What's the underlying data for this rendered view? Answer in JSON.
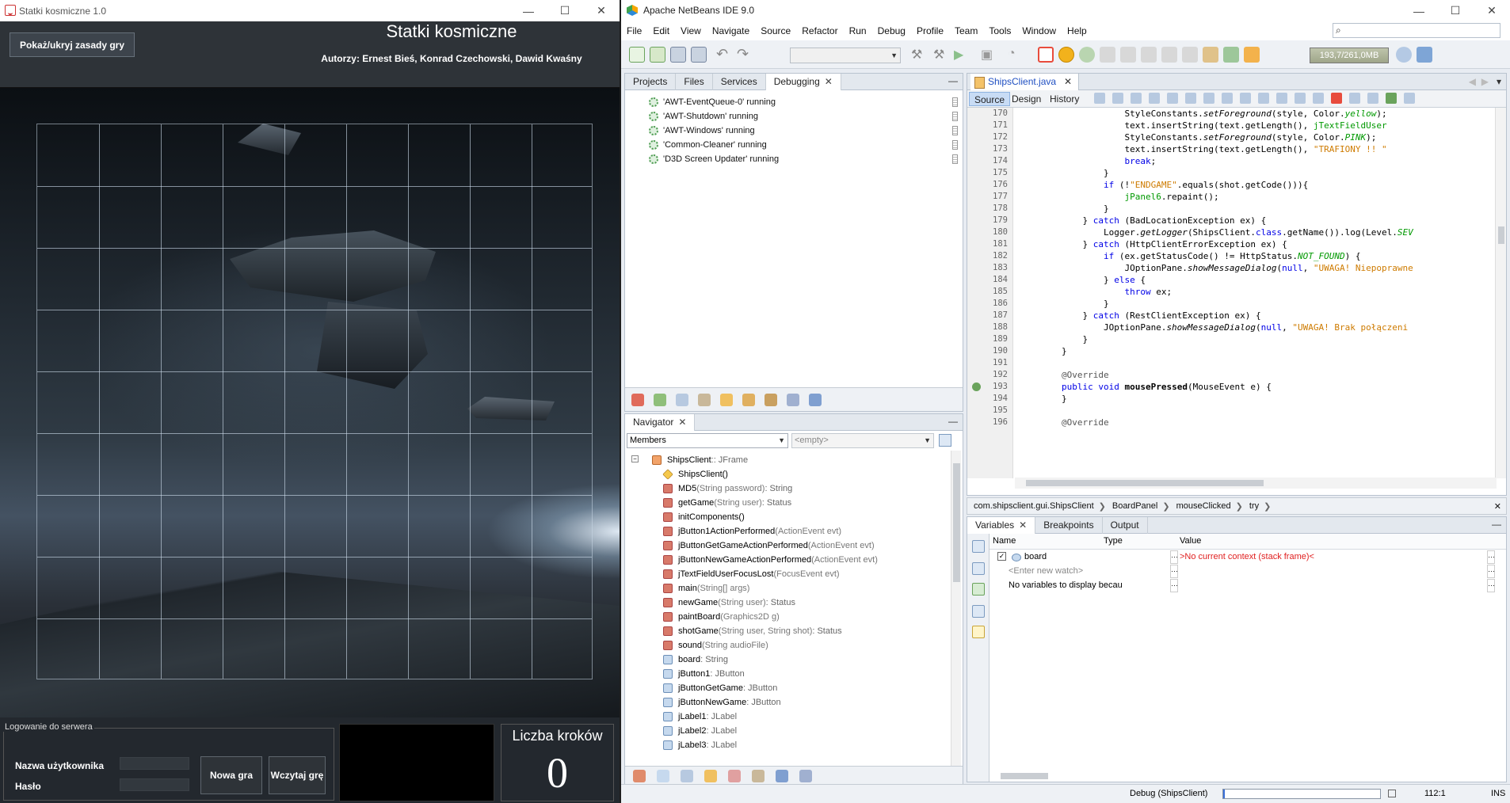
{
  "game_window": {
    "title": "Statki kosmiczne 1.0",
    "rules_button": "Pokaż/ukryj zasady gry",
    "heading": "Statki kosmiczne",
    "authors": "Autorzy: Ernest Bieś, Konrad Czechowski, Dawid Kwaśny",
    "login_legend": "Logowanie do serwera",
    "username_label": "Nazwa użytkownika",
    "password_label": "Hasło",
    "new_game_button": "Nowa gra",
    "load_game_button": "Wczytaj grę",
    "steps_title": "Liczba kroków",
    "steps_value": "0",
    "window_controls": [
      "—",
      "☐",
      "✕"
    ]
  },
  "ide": {
    "title": "Apache NetBeans IDE 9.0",
    "window_controls": [
      "—",
      "☐",
      "✕"
    ],
    "menu": [
      "File",
      "Edit",
      "View",
      "Navigate",
      "Source",
      "Refactor",
      "Run",
      "Debug",
      "Profile",
      "Team",
      "Tools",
      "Window",
      "Help"
    ],
    "memory": "193,7/261,0MB",
    "panes": {
      "top_tabs": [
        "Projects",
        "Files",
        "Services",
        "Debugging"
      ],
      "threads": [
        "'AWT-EventQueue-0' running",
        "'AWT-Shutdown' running",
        "'AWT-Windows' running",
        "'Common-Cleaner' running",
        "'D3D Screen Updater' running"
      ],
      "navigator_tab": "Navigator",
      "navigator_filter": "Members",
      "navigator_filter2": "<empty>",
      "members": [
        {
          "name": "ShipsClient",
          "ret": " :: JFrame",
          "par": ""
        },
        {
          "name": "ShipsClient()",
          "ret": "",
          "par": ""
        },
        {
          "name": "MD5",
          "par": "(String password)",
          "ret": " : String"
        },
        {
          "name": "getGame",
          "par": "(String user)",
          "ret": " : Status"
        },
        {
          "name": "initComponents()",
          "par": "",
          "ret": ""
        },
        {
          "name": "jButton1ActionPerformed",
          "par": "(ActionEvent evt)",
          "ret": ""
        },
        {
          "name": "jButtonGetGameActionPerformed",
          "par": "(ActionEvent evt)",
          "ret": ""
        },
        {
          "name": "jButtonNewGameActionPerformed",
          "par": "(ActionEvent evt)",
          "ret": ""
        },
        {
          "name": "jTextFieldUserFocusLost",
          "par": "(FocusEvent evt)",
          "ret": ""
        },
        {
          "name": "main",
          "par": "(String[] args)",
          "ret": ""
        },
        {
          "name": "newGame",
          "par": "(String user)",
          "ret": " : Status"
        },
        {
          "name": "paintBoard",
          "par": "(Graphics2D g)",
          "ret": ""
        },
        {
          "name": "shotGame",
          "par": "(String user, String shot)",
          "ret": " : Status"
        },
        {
          "name": "sound",
          "par": "(String audioFile)",
          "ret": ""
        },
        {
          "name": "board",
          "par": "",
          "ret": " : String"
        },
        {
          "name": "jButton1",
          "par": "",
          "ret": " : JButton"
        },
        {
          "name": "jButtonGetGame",
          "par": "",
          "ret": " : JButton"
        },
        {
          "name": "jButtonNewGame",
          "par": "",
          "ret": " : JButton"
        },
        {
          "name": "jLabel1",
          "par": "",
          "ret": " : JLabel"
        },
        {
          "name": "jLabel2",
          "par": "",
          "ret": " : JLabel"
        },
        {
          "name": "jLabel3",
          "par": "",
          "ret": " : JLabel"
        }
      ]
    },
    "editor": {
      "file_tab": "ShipsClient.java",
      "modes": [
        "Source",
        "Design",
        "History"
      ],
      "lines": [
        {
          "n": "170",
          "html": "                    StyleConstants.<span class='it'>setForeground</span>(style, Color.<span class='green it'>yellow</span>);"
        },
        {
          "n": "171",
          "html": "                    text.insertString(text.getLength(), <span class='green'>jTextFieldUser</span>"
        },
        {
          "n": "172",
          "html": "                    StyleConstants.<span class='it'>setForeground</span>(style, Color.<span class='green it'>PINK</span>);"
        },
        {
          "n": "173",
          "html": "                    text.insertString(text.getLength(), <span class='str'>\"TRAFIONY !! \"</span>"
        },
        {
          "n": "174",
          "html": "                    <span class='kw'>break</span>;"
        },
        {
          "n": "175",
          "html": "                }"
        },
        {
          "n": "176",
          "html": "                <span class='kw'>if</span> (!<span class='str'>\"ENDGAME\"</span>.equals(shot.getCode())){"
        },
        {
          "n": "177",
          "html": "                    <span class='green'>jPanel6</span>.repaint();"
        },
        {
          "n": "178",
          "html": "                }"
        },
        {
          "n": "179",
          "html": "            } <span class='kw'>catch</span> (BadLocationException ex) {"
        },
        {
          "n": "180",
          "html": "                Logger.<span class='it'>getLogger</span>(ShipsClient.<span class='kw'>class</span>.getName()).log(Level.<span class='green it'>SEV</span>"
        },
        {
          "n": "181",
          "html": "            } <span class='kw'>catch</span> (HttpClientErrorException ex) {"
        },
        {
          "n": "182",
          "html": "                <span class='kw'>if</span> (ex.getStatusCode() != HttpStatus.<span class='green it'>NOT_FOUND</span>) {"
        },
        {
          "n": "183",
          "html": "                    JOptionPane.<span class='it'>showMessageDialog</span>(<span class='kw'>null</span>, <span class='str'>\"UWAGA! Niepoprawne</span>"
        },
        {
          "n": "184",
          "html": "                } <span class='kw'>else</span> {"
        },
        {
          "n": "185",
          "html": "                    <span class='kw'>throw</span> ex;"
        },
        {
          "n": "186",
          "html": "                }"
        },
        {
          "n": "187",
          "html": "            } <span class='kw'>catch</span> (RestClientException ex) {"
        },
        {
          "n": "188",
          "html": "                JOptionPane.<span class='it'>showMessageDialog</span>(<span class='kw'>null</span>, <span class='str'>\"UWAGA! Brak połączeni</span>"
        },
        {
          "n": "189",
          "html": "            }"
        },
        {
          "n": "190",
          "html": "        }"
        },
        {
          "n": "191",
          "html": ""
        },
        {
          "n": "192",
          "html": "        <span class='ann'>@Override</span>"
        },
        {
          "n": "193",
          "html": "        <span class='kw'>public void</span> <b>mousePressed</b>(MouseEvent e) {"
        },
        {
          "n": "194",
          "html": "        }"
        },
        {
          "n": "195",
          "html": ""
        },
        {
          "n": "196",
          "html": "        <span class='ann'>@Override</span>"
        }
      ]
    },
    "breadcrumb": [
      "com.shipsclient.gui.ShipsClient",
      "BoardPanel",
      "mouseClicked",
      "try"
    ],
    "variables": {
      "tabs": [
        "Variables",
        "Breakpoints",
        "Output"
      ],
      "columns": [
        "Name",
        "Type",
        "Value"
      ],
      "rows": [
        {
          "name": "board",
          "type": "",
          "value": ">No current context (stack frame)<"
        },
        {
          "name": "<Enter new watch>",
          "type": "",
          "value": ""
        },
        {
          "name": "No variables to display becau",
          "type": "",
          "value": ""
        }
      ]
    },
    "status": {
      "text": "Debug (ShipsClient)",
      "position": "112:1",
      "mode": "INS"
    }
  }
}
